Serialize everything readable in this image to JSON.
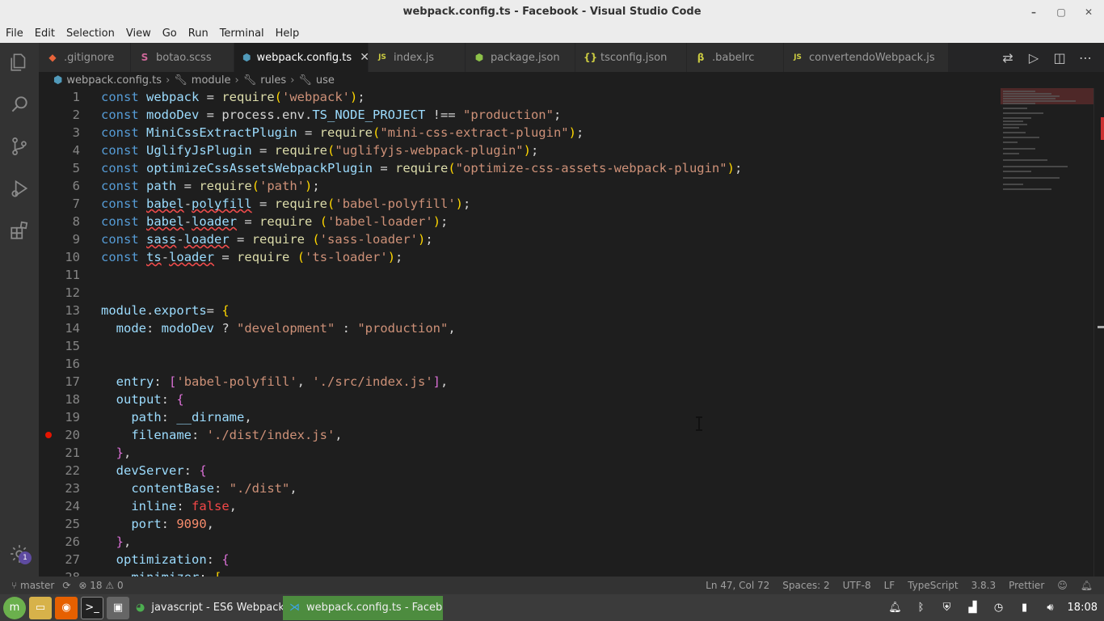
{
  "window": {
    "title": "webpack.config.ts - Facebook - Visual Studio Code",
    "controls": [
      "–",
      "▢",
      "✕"
    ]
  },
  "menu": [
    "File",
    "Edit",
    "Selection",
    "View",
    "Go",
    "Run",
    "Terminal",
    "Help"
  ],
  "activity_bar": {
    "icons": [
      "explorer-icon",
      "search-icon",
      "source-control-icon",
      "run-debug-icon",
      "extensions-icon",
      "manage-gear-icon"
    ],
    "manage_badge": "1"
  },
  "tabs": [
    {
      "label": ".gitignore",
      "icon": "◆",
      "icon_color": "#e8643a"
    },
    {
      "label": "botao.scss",
      "icon": "S",
      "icon_color": "#cd6799"
    },
    {
      "label": "webpack.config.ts",
      "icon": "⬢",
      "icon_color": "#519aba",
      "active": true,
      "close": "✕"
    },
    {
      "label": "index.js",
      "icon": "JS",
      "icon_color": "#cbcb41"
    },
    {
      "label": "package.json",
      "icon": "⬢",
      "icon_color": "#8dc149"
    },
    {
      "label": "tsconfig.json",
      "icon": "{}",
      "icon_color": "#cbcb41"
    },
    {
      "label": ".babelrc",
      "icon": "β",
      "icon_color": "#cbcb41"
    },
    {
      "label": "convertendoWebpack.js",
      "icon": "JS",
      "icon_color": "#cbcb41"
    }
  ],
  "tab_actions": [
    "compare-icon",
    "run-icon",
    "split-editor-icon",
    "more-icon"
  ],
  "breadcrumb": [
    "webpack.config.ts",
    "module",
    "rules",
    "use"
  ],
  "editor": {
    "line_numbers": [
      "1",
      "2",
      "3",
      "4",
      "5",
      "6",
      "7",
      "8",
      "9",
      "10",
      "11",
      "12",
      "13",
      "14",
      "15",
      "16",
      "17",
      "18",
      "19",
      "20",
      "21",
      "22",
      "23",
      "24",
      "25",
      "26",
      "27",
      "28"
    ],
    "breakpoint_line": "20"
  },
  "status": {
    "branch": "master",
    "sync": "⟳",
    "errors": "18",
    "warnings": "0",
    "position": "Ln 47, Col 72",
    "spaces": "Spaces: 2",
    "encoding": "UTF-8",
    "eol": "LF",
    "language": "TypeScript",
    "version": "3.8.3",
    "formatter": "Prettier"
  },
  "taskbar": {
    "tasks": [
      {
        "label": "javascript - ES6 Webpack R...",
        "icon": "chrome-icon"
      },
      {
        "label": "webpack.config.ts - Faceb...",
        "icon": "vscode-icon",
        "active": true
      }
    ],
    "clock": "18:08"
  },
  "colors": {
    "editor_bg": "#1e1e1e",
    "activity_bg": "#333333",
    "active_task": "#4d8c3f"
  }
}
